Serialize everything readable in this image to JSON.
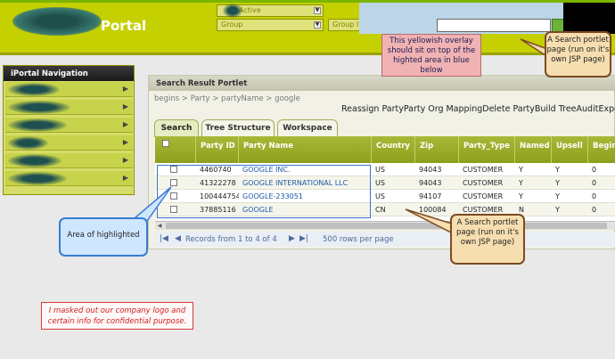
{
  "header": {
    "title": "Portal",
    "status_select": "Active",
    "group_select": "Group",
    "group_id_select": "Group ID"
  },
  "nav": {
    "title": "iPortal Navigation",
    "item_count": 6
  },
  "results": {
    "title": "Search Result Portlet",
    "breadcrumb": "begins > Party > partyName > google",
    "actions": [
      "Reassign Party",
      "Party Org Mapping",
      "Delete Party",
      "Build Tree",
      "Audit",
      "Export",
      "Su"
    ],
    "actions_text": "Reassign PartyParty Org MappingDelete PartyBuild TreeAuditExportSu",
    "tabs": [
      "Search",
      "Tree Structure",
      "Workspace"
    ],
    "columns": [
      "Party ID",
      "Party Name",
      "Country",
      "Zip",
      "Party_Type",
      "Named",
      "Upsell",
      "Begin"
    ],
    "rows": [
      {
        "id": "4460740",
        "name": "GOOGLE INC.",
        "country": "US",
        "zip": "94043",
        "type": "CUSTOMER",
        "named": "Y",
        "upsell": "Y",
        "begin": "0"
      },
      {
        "id": "41322278",
        "name": "GOOGLE INTERNATIONAL LLC",
        "country": "US",
        "zip": "94043",
        "type": "CUSTOMER",
        "named": "Y",
        "upsell": "Y",
        "begin": "0"
      },
      {
        "id": "100444754",
        "name": "GOOGLE-233051",
        "country": "US",
        "zip": "94107",
        "type": "CUSTOMER",
        "named": "Y",
        "upsell": "Y",
        "begin": "0"
      },
      {
        "id": "37885116",
        "name": "GOOGLE",
        "country": "CN",
        "zip": "100084",
        "type": "CUSTOMER",
        "named": "N",
        "upsell": "Y",
        "begin": "0"
      }
    ],
    "pager_text": "Records from 1 to 4 of 4",
    "rows_per_page": "500 rows per page"
  },
  "callouts": {
    "overlay_note": "This yellowish overlay should sit on top of the highted area in blue below",
    "jsp_note_top": "A Search portlet page (run on it's own JSP page)",
    "jsp_note_mid": "A Search portlet page (run on it's own JSP page)",
    "highlight_note": "Area of highlighted",
    "confidential_note": "I masked out our company logo and certain info for confidential purpose."
  },
  "colors": {
    "header": "#c4d000",
    "table_header": "#9aab28",
    "callout_orange": "#f6deb0",
    "callout_pink": "#f0b2b2",
    "callout_blue": "#cfe6ff"
  }
}
